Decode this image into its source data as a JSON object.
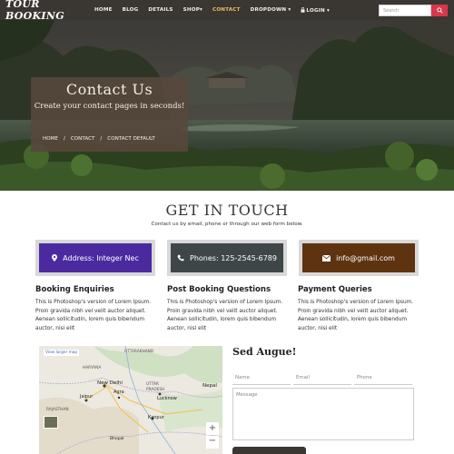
{
  "nav": {
    "brand": "TOUR BOOKING",
    "items": [
      {
        "label": "HOME"
      },
      {
        "label": "BLOG"
      },
      {
        "label": "DETAILS"
      },
      {
        "label": "SHOP▾"
      },
      {
        "label": "CONTACT",
        "active": true
      },
      {
        "label": "DROPDOWN ▾"
      },
      {
        "label": "LOGIN ▾"
      }
    ],
    "search_placeholder": "Search"
  },
  "hero": {
    "title": "Contact Us",
    "subtitle": "Create your contact pages in seconds!",
    "breadcrumb": [
      "HOME",
      "CONTACT",
      "CONTACT DEFAULT"
    ]
  },
  "get_in_touch": {
    "title": "GET IN TOUCH",
    "subtitle": "Contact us by email, phone or through our web form below."
  },
  "cards": [
    {
      "label": "Address: Integer Nec",
      "icon": "map-marker-icon",
      "color": "#4b2aa0"
    },
    {
      "label": "Phones: 125-2545-6789",
      "icon": "phone-icon",
      "color": "#3e4647"
    },
    {
      "label": "info@gmail.com",
      "icon": "envelope-icon",
      "color": "#5e3310"
    }
  ],
  "columns": [
    {
      "title": "Booking Enquiries",
      "text": "This is Photoshop's version of Lorem Ipsum. Proin gravida nibh vel velit auctor aliquet. Aenean sollicitudin, lorem quis bibendum auctor, nisi elit"
    },
    {
      "title": "Post Booking Questions",
      "text": "This is Photoshop's version of Lorem Ipsum. Proin gravida nibh vel velit auctor aliquet. Aenean sollicitudin, lorem quis bibendum auctor, nisi elit"
    },
    {
      "title": "Payment Queries",
      "text": "This is Photoshop's version of Lorem Ipsum. Proin gravida nibh vel velit auctor aliquet. Aenean sollicitudin, lorem quis bibendum auctor, nisi elit"
    }
  ],
  "map": {
    "link": "View larger map",
    "labels": [
      "UTTARAKHAND",
      "HARYANA",
      "New Delhi",
      "Jaipur",
      "UTTAR PRADESH",
      "Lucknow",
      "RAJASTHAN",
      "Kanpur",
      "Agra",
      "Nepal",
      "Bhopal"
    ]
  },
  "form": {
    "title": "Sed Augue!",
    "name_placeholder": "Name",
    "email_placeholder": "Email",
    "phone_placeholder": "Phone",
    "message_placeholder": "Message"
  },
  "colors": {
    "nav_bg": "#3a3631",
    "active": "#e6c060",
    "search_button": "#d9374b"
  }
}
